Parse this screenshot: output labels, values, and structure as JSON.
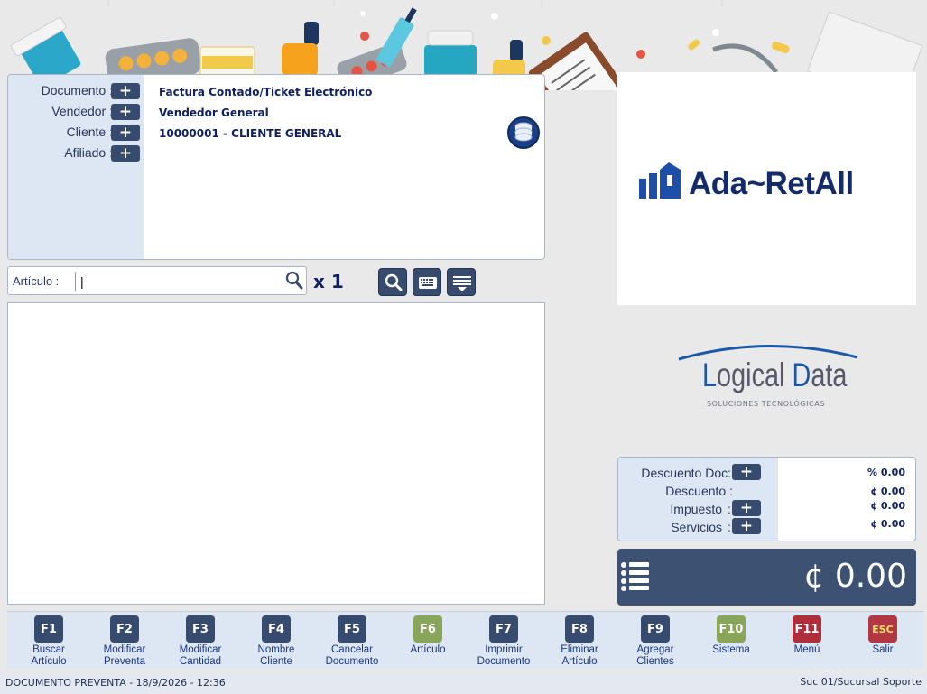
{
  "header": {
    "fields": [
      {
        "label": "Documento :",
        "value": "Factura Contado/Ticket Electrónico"
      },
      {
        "label": "Vendedor :",
        "value": "Vendedor General"
      },
      {
        "label": "Cliente :",
        "value": "10000001 - CLIENTE GENERAL"
      },
      {
        "label": "Afiliado :",
        "value": ""
      }
    ],
    "plus_symbol": "+"
  },
  "article": {
    "label": "Artículo :",
    "value": "|",
    "quantity": "x 1"
  },
  "logo": {
    "text_main": "Ada~RetAll",
    "brand_color": "#142b6b"
  },
  "brand2": {
    "name_first_letter": "L",
    "name_first_rest": "ogical ",
    "name_second_letter": "D",
    "name_second_rest": "ata",
    "tagline": "SOLUCIONES TECNOLÓGICAS"
  },
  "totals": [
    {
      "label": "Descuento Doc.",
      "value": "% 0.00",
      "has_button": true
    },
    {
      "label": "Descuento :",
      "value": "¢ 0.00",
      "has_button": false
    },
    {
      "label": "Impuesto",
      "value": "¢ 0.00",
      "has_button": true
    },
    {
      "label": "Servicios",
      "value": "¢ 0.00",
      "has_button": true
    }
  ],
  "grand_total": "¢ 0.00",
  "function_keys": [
    {
      "key": "F1",
      "label_line1": "Buscar",
      "label_line2": "Artículo",
      "color": "#364b6e"
    },
    {
      "key": "F2",
      "label_line1": "Modificar",
      "label_line2": "Preventa",
      "color": "#364b6e"
    },
    {
      "key": "F3",
      "label_line1": "Modificar",
      "label_line2": "Cantidad",
      "color": "#364b6e"
    },
    {
      "key": "F4",
      "label_line1": "Nombre",
      "label_line2": "Cliente",
      "color": "#364b6e"
    },
    {
      "key": "F5",
      "label_line1": "Cancelar",
      "label_line2": "Documento",
      "color": "#364b6e"
    },
    {
      "key": "F6",
      "label_line1": "Artículo",
      "label_line2": "",
      "color": "#89a55a"
    },
    {
      "key": "F7",
      "label_line1": "Imprimir",
      "label_line2": "Documento",
      "color": "#364b6e"
    },
    {
      "key": "F8",
      "label_line1": "Eliminar",
      "label_line2": "Artículo",
      "color": "#364b6e"
    },
    {
      "key": "F9",
      "label_line1": "Agregar",
      "label_line2": "Clientes",
      "color": "#364b6e"
    },
    {
      "key": "F10",
      "label_line1": "Sistema",
      "label_line2": "",
      "color": "#89a55a"
    },
    {
      "key": "F11",
      "label_line1": "Menú",
      "label_line2": "",
      "color": "#b02e3a"
    },
    {
      "key": "ESC",
      "label_line1": "Salir",
      "label_line2": "",
      "color": "#b33743"
    }
  ],
  "status": {
    "left": "DOCUMENTO PREVENTA - 18/9/2026 - 12:36",
    "right": "Suc 01/Sucursal Soporte"
  }
}
